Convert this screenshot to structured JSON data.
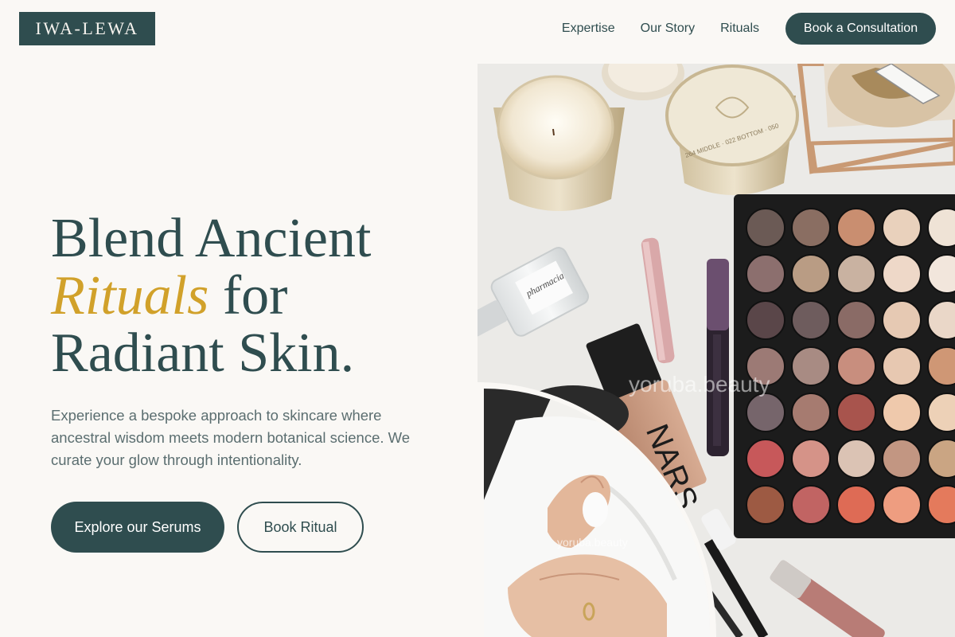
{
  "brand": {
    "logo_text": "IWA-LEWA"
  },
  "nav": {
    "links": [
      "Expertise",
      "Our Story",
      "Rituals"
    ],
    "cta_label": "Book a Consultation"
  },
  "hero": {
    "title_line1": "Blend Ancient",
    "title_accent": "Rituals",
    "title_line2_rest": " for",
    "title_line3": "Radiant Skin.",
    "subtitle": "Experience a bespoke approach to skincare where ancestral wisdom meets modern botanical science. We curate your glow through intentionality.",
    "primary_button": "Explore our Serums",
    "secondary_button": "Book Ritual"
  },
  "image": {
    "watermark_main": "yoruba.beauty",
    "watermark_small": "yoruba.beauty",
    "perfume_label": "pharmacia",
    "foundation_label": "NARS",
    "candle_lid_text": "264 MIDDLE · 022 BOTTOM · 050"
  },
  "colors": {
    "primary": "#2f4d4f",
    "accent": "#d1a12a",
    "background": "#faf8f5"
  }
}
